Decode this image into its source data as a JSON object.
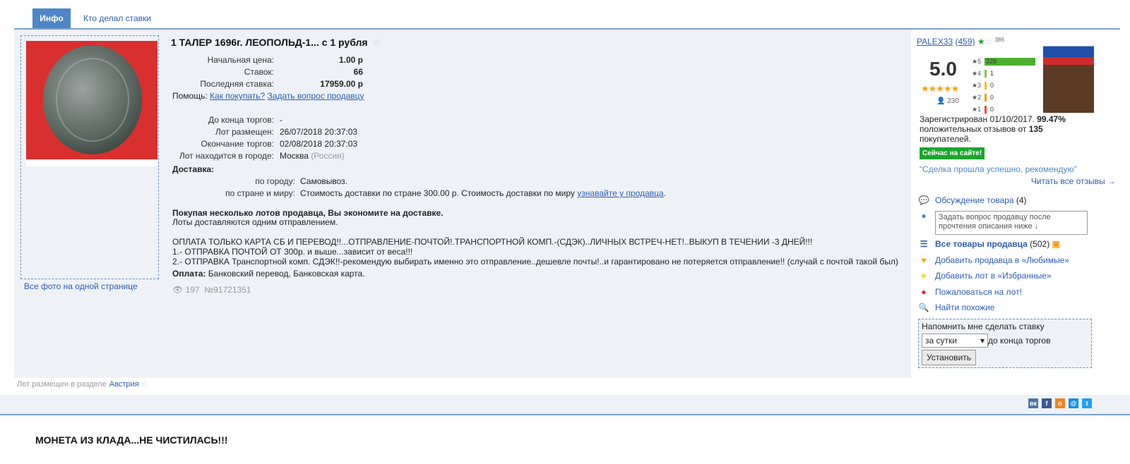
{
  "tabs": {
    "info": "Инфо",
    "bidders": "Кто делал ставки"
  },
  "lot": {
    "title": "1 ТАЛЕР 1696г. ЛЕОПОЛЬД-1... с 1 рубля",
    "start_price_label": "Начальная цена:",
    "start_price": "1.00 р",
    "bids_label": "Ставок:",
    "bids": "66",
    "last_bid_label": "Последняя ставка:",
    "last_bid": "17959.00 р",
    "help_label": "Помощь:",
    "help_link1": "Как покупать?",
    "help_link2": "Задать вопрос продавцу",
    "ends_in_label": "До конца торгов:",
    "ends_in": "-",
    "posted_label": "Лот размещен:",
    "posted": "26/07/2018 20:37:03",
    "end_label": "Окончание торгов:",
    "end": "02/08/2018 20:37:03",
    "city_label": "Лот находится в городе:",
    "city": "Москва",
    "country": "(Россия)",
    "delivery_label": "Доставка:",
    "by_city_label": "по городу:",
    "by_city": "Самовывоз.",
    "by_country_label": "по стране и миру:",
    "by_country": "Стоимость доставки по стране 300.00 р. Стоимость доставки по миру",
    "by_country_link": "узнавайте у продавца",
    "save_bold": "Покупая несколько лотов продавца, Вы экономите на доставке.",
    "save_text": "Лоты доставляются одним отправлением.",
    "desc1": "ОПЛАТА ТОЛЬКО КАРТА СБ И ПЕРЕВОД!!...ОТПРАВЛЕНИЕ-ПОЧТОЙ!.ТРАНСПОРТНОЙ КОМП.-(СДЭК)..ЛИЧНЫХ ВСТРЕЧ-НЕТ!..ВЫКУП В ТЕЧЕНИИ -3 ДНЕЙ!!!",
    "desc2": "1.- ОТПРАВКА ПОЧТОЙ ОТ 300р. и выше...зависит от веса!!!",
    "desc3": "2.- ОТПРАВКА Транспортной комп. СДЭК!!-рекомендую выбирать именно это отправление..дешевле почты!..и гарантировано не потеряется отправление!! (случай с почтой такой был)",
    "payment_label": "Оплата:",
    "payment": "Банковский перевод, Банковская карта.",
    "views": "197",
    "lot_no": "№91721351",
    "all_photos": "Все фото на одной странице"
  },
  "seller": {
    "name": "PALEX33",
    "rating_count": "(459)",
    "small_count": "386",
    "score": "5.0",
    "reviews": "230",
    "bars": [
      {
        "label": "★5",
        "value": "229",
        "color": "#4caf2e"
      },
      {
        "label": "★4",
        "value": "1",
        "color": "#8bc34a"
      },
      {
        "label": "★3",
        "value": "0",
        "color": "#f0c419"
      },
      {
        "label": "★2",
        "value": "0",
        "color": "#f39c12"
      },
      {
        "label": "★1",
        "value": "0",
        "color": "#e74c3c"
      }
    ],
    "registered": "Зарегистрирован 01/10/2017.",
    "positive_pct": "99.47%",
    "positive_text1": "положительных отзывов от",
    "positive_count": "135",
    "positive_text2": "покупателей.",
    "online": "Сейчас на сайте!",
    "quote": "“Сделка прошла успешно, рекомендую”",
    "read_all": "Читать все отзывы →"
  },
  "menu": {
    "discussion": "Обсуждение товара",
    "discussion_count": "(4)",
    "ask_placeholder": "Задать вопрос продавцу после прочтения описания ниже ↓",
    "all_items": "Все товары продавца",
    "all_items_count": "(502)",
    "add_fav_seller": "Добавить продавца в «Любимые»",
    "add_fav_lot": "Добавить лот в «Избранные»",
    "complain": "Пожаловаться на лот!",
    "similar": "Найти похожие"
  },
  "remind": {
    "title": "Напомнить мне сделать ставку",
    "option": "за сутки",
    "suffix": "до конца торгов",
    "button": "Установить"
  },
  "section": {
    "label": "Лот размещен в разделе",
    "link": "Австрия"
  },
  "bottom": {
    "title": "МОНЕТА ИЗ КЛАДА...НЕ ЧИСТИЛАСЬ!!!"
  }
}
